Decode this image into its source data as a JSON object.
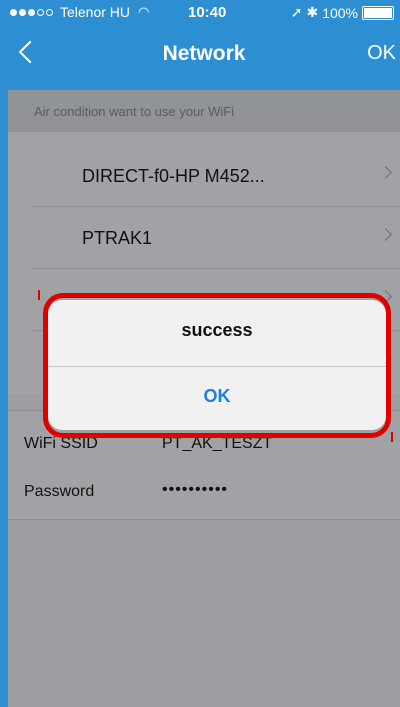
{
  "status_bar": {
    "carrier": "Telenor HU",
    "time": "10:40",
    "battery": "100%"
  },
  "nav": {
    "title": "Network",
    "right_button": "OK"
  },
  "hint": "Air condition want to use your WiFi",
  "networks": [
    {
      "name": "DIRECT-f0-HP M452..."
    },
    {
      "name": "PTRAK1"
    }
  ],
  "form": {
    "ssid_label": "WiFi SSID",
    "ssid_value": "PT_AK_TESZT",
    "password_label": "Password",
    "password_value": "••••••••••"
  },
  "alert": {
    "title": "success",
    "button": "OK"
  },
  "colors": {
    "nav_bg": "#2d8fd2",
    "alert_button": "#1b7fe0",
    "highlight": "#e00000"
  }
}
